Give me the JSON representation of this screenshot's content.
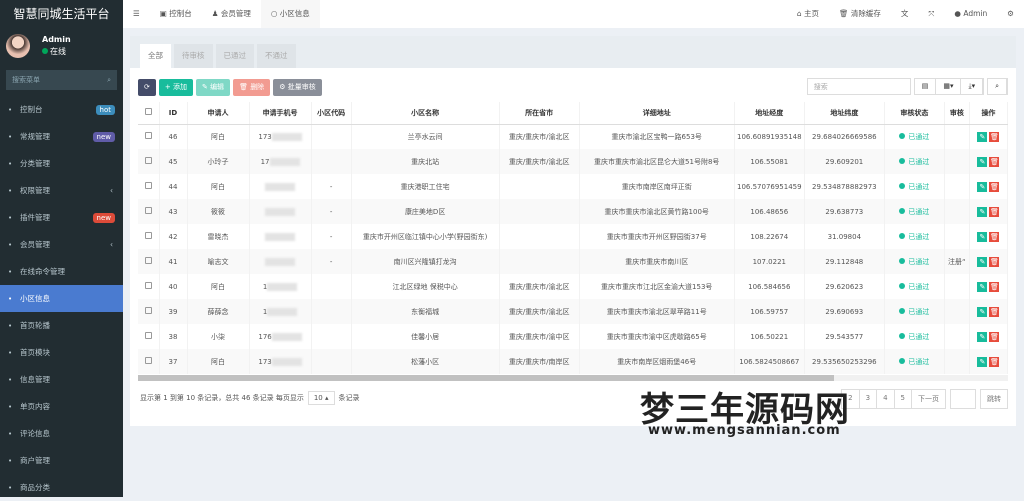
{
  "app_title": "智慧同城生活平台",
  "user": {
    "name": "Admin",
    "status": "在线"
  },
  "sidebar": {
    "search_placeholder": "搜索菜单",
    "items": [
      {
        "label": "控制台",
        "icon": "dashboard-icon",
        "badge": "hot",
        "badge_color": "#3c8dbc"
      },
      {
        "label": "常规管理",
        "icon": "cogs-icon",
        "badge": "new",
        "badge_color": "#605ca8"
      },
      {
        "label": "分类管理",
        "icon": "leaf-icon"
      },
      {
        "label": "权限管理",
        "icon": "group-icon",
        "arrow": "‹"
      },
      {
        "label": "插件管理",
        "icon": "rocket-icon",
        "badge": "new",
        "badge_color": "#dd4b39"
      },
      {
        "label": "会员管理",
        "icon": "user-icon",
        "arrow": "‹"
      },
      {
        "label": "在线命令管理",
        "icon": "terminal-icon"
      },
      {
        "label": "小区信息",
        "icon": "circle-icon",
        "active": true
      },
      {
        "label": "首页轮播",
        "icon": "circle-icon"
      },
      {
        "label": "首页模块",
        "icon": "circle-icon"
      },
      {
        "label": "信息管理",
        "icon": "circle-icon"
      },
      {
        "label": "单页内容",
        "icon": "circle-icon"
      },
      {
        "label": "评论信息",
        "icon": "comment-icon"
      },
      {
        "label": "商户管理",
        "icon": "circle-icon"
      },
      {
        "label": "商品分类",
        "icon": "circle-icon"
      }
    ]
  },
  "topbar": {
    "tabs": [
      "控制台",
      "会员管理",
      "小区信息"
    ],
    "home": "主页",
    "clear_cache": "清除缓存",
    "admin": "Admin"
  },
  "tabs": [
    "全部",
    "待审核",
    "已通过",
    "不通过"
  ],
  "toolbar": {
    "add": "添加",
    "edit": "编辑",
    "delete": "删除",
    "batch": "批量审核",
    "search_placeholder": "搜索"
  },
  "colors": {
    "refresh": "#444c69",
    "add": "#18bc9c",
    "edit": "#7fd8c6",
    "delete": "#f29b91",
    "batch": "#8a8f99"
  },
  "columns": [
    "ID",
    "申请人",
    "申请手机号",
    "小区代码",
    "小区名称",
    "所在省市",
    "详细地址",
    "地址经度",
    "地址纬度",
    "审核状态",
    "审核",
    "操作"
  ],
  "rows": [
    {
      "id": "46",
      "name": "阿白",
      "phone": "173",
      "code": "",
      "cname": "兰亭水云间",
      "city": "重庆/重庆市/渝北区",
      "addr": "重庆市渝北区宝鸭一路653号",
      "lng": "106.60891935148",
      "lat": "29.684026669586",
      "status": "已通过",
      "note": ""
    },
    {
      "id": "45",
      "name": "小玲子",
      "phone": "17",
      "code": "",
      "cname": "重庆北站",
      "city": "重庆/重庆市/渝北区",
      "addr": "重庆市重庆市渝北区昆仑大道51号附8号",
      "lng": "106.55081",
      "lat": "29.609201",
      "status": "已通过",
      "note": ""
    },
    {
      "id": "44",
      "name": "阿白",
      "phone": "",
      "code": "-",
      "cname": "重庆港职工住宅",
      "city": "",
      "addr": "重庆市南岸区南坪正街",
      "lng": "106.57076951459",
      "lat": "29.534878882973",
      "status": "已通过",
      "note": ""
    },
    {
      "id": "43",
      "name": "筱筱",
      "phone": "",
      "code": "-",
      "cname": "康庄美地D区",
      "city": "",
      "addr": "重庆市重庆市渝北区黄竹路100号",
      "lng": "106.48656",
      "lat": "29.638773",
      "status": "已通过",
      "note": ""
    },
    {
      "id": "42",
      "name": "雷晓杰",
      "phone": "",
      "code": "-",
      "cname": "重庆市开州区临江镇中心小学(野园街东)",
      "city": "",
      "addr": "重庆市重庆市开州区野园街37号",
      "lng": "108.22674",
      "lat": "31.09804",
      "status": "已通过",
      "note": ""
    },
    {
      "id": "41",
      "name": "喻志文",
      "phone": "",
      "code": "-",
      "cname": "南川区兴隆镇打龙沟",
      "city": "",
      "addr": "重庆市重庆市南川区",
      "lng": "107.0221",
      "lat": "29.112848",
      "status": "已通过",
      "note": "注册“"
    },
    {
      "id": "40",
      "name": "阿白",
      "phone": "1",
      "code": "",
      "cname": "江北区绿地 保税中心",
      "city": "重庆/重庆市/渝北区",
      "addr": "重庆市重庆市江北区金渝大道153号",
      "lng": "106.584656",
      "lat": "29.620623",
      "status": "已通过",
      "note": ""
    },
    {
      "id": "39",
      "name": "薛薛念",
      "phone": "1",
      "code": "",
      "cname": "东衡福城",
      "city": "重庆/重庆市/渝北区",
      "addr": "重庆市重庆市渝北区翠苹路11号",
      "lng": "106.59757",
      "lat": "29.690693",
      "status": "已通过",
      "note": ""
    },
    {
      "id": "38",
      "name": "小柒",
      "phone": "176",
      "code": "",
      "cname": "佳馨小居",
      "city": "重庆/重庆市/渝中区",
      "addr": "重庆市重庆市渝中区虎歇路65号",
      "lng": "106.50221",
      "lat": "29.543577",
      "status": "已通过",
      "note": ""
    },
    {
      "id": "37",
      "name": "阿白",
      "phone": "173",
      "code": "",
      "cname": "松藩小区",
      "city": "重庆/重庆市/南岸区",
      "addr": "重庆市南岸区烟雨堡46号",
      "lng": "106.5824508667",
      "lat": "29.535650253296",
      "status": "已通过",
      "note": ""
    }
  ],
  "pagination": {
    "info": "显示第 1 到第 10 条记录，总共 46 条记录 每页显示",
    "page_size": "10",
    "suffix": "条记录",
    "pages": [
      "2",
      "3",
      "4",
      "5"
    ],
    "next": "下一页",
    "jump": "跳转"
  },
  "watermark": {
    "text": "梦三年源码网",
    "url": "www.mengsannian.com"
  }
}
